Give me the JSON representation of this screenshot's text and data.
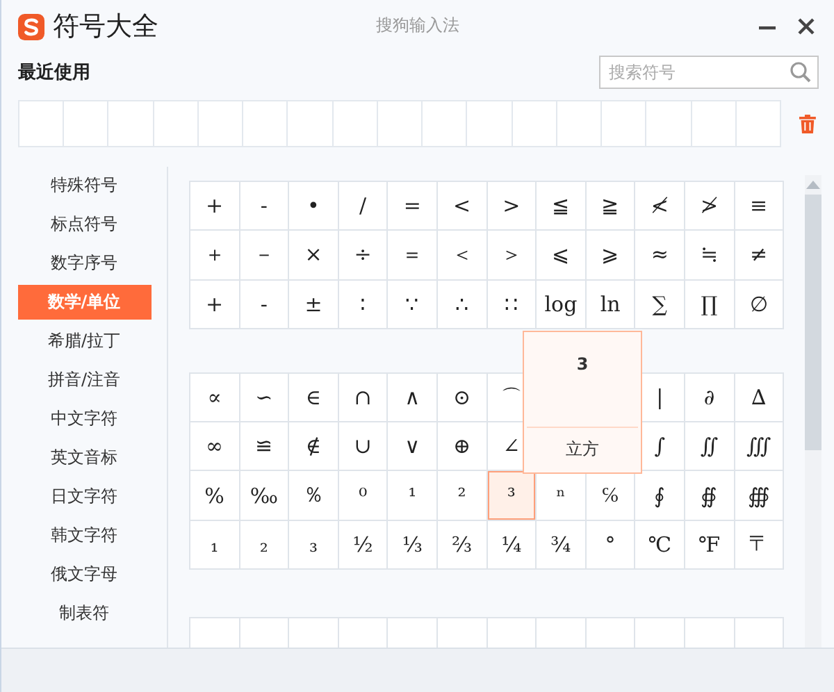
{
  "window": {
    "title": "符号大全",
    "app_name": "搜狗输入法"
  },
  "recent": {
    "label": "最近使用"
  },
  "search": {
    "placeholder": "搜索符号"
  },
  "sidebar": {
    "items": [
      {
        "label": "特殊符号",
        "selected": false
      },
      {
        "label": "标点符号",
        "selected": false
      },
      {
        "label": "数字序号",
        "selected": false
      },
      {
        "label": "数学/单位",
        "selected": true
      },
      {
        "label": "希腊/拉丁",
        "selected": false
      },
      {
        "label": "拼音/注音",
        "selected": false
      },
      {
        "label": "中文字符",
        "selected": false
      },
      {
        "label": "英文音标",
        "selected": false
      },
      {
        "label": "日文字符",
        "selected": false
      },
      {
        "label": "韩文字符",
        "selected": false
      },
      {
        "label": "俄文字母",
        "selected": false
      },
      {
        "label": "制表符",
        "selected": false
      }
    ]
  },
  "symbol_grids": [
    {
      "rows": [
        [
          {
            "s": "+",
            "selected": false
          },
          {
            "s": "-",
            "selected": false
          },
          {
            "s": "•",
            "selected": false
          },
          {
            "s": "/",
            "selected": false
          },
          {
            "s": "=",
            "selected": false
          },
          {
            "s": "<",
            "selected": false
          },
          {
            "s": ">",
            "selected": false
          },
          {
            "s": "≦",
            "selected": false
          },
          {
            "s": "≧",
            "selected": false
          },
          {
            "s": "≮",
            "selected": false
          },
          {
            "s": "≯",
            "selected": false
          },
          {
            "s": "≡",
            "selected": false
          }
        ],
        [
          {
            "s": "＋",
            "selected": false
          },
          {
            "s": "－",
            "selected": false
          },
          {
            "s": "×",
            "selected": false
          },
          {
            "s": "÷",
            "selected": false
          },
          {
            "s": "＝",
            "selected": false
          },
          {
            "s": "＜",
            "selected": false
          },
          {
            "s": "＞",
            "selected": false
          },
          {
            "s": "⩽",
            "selected": false
          },
          {
            "s": "⩾",
            "selected": false
          },
          {
            "s": "≈",
            "selected": false
          },
          {
            "s": "≒",
            "selected": false
          },
          {
            "s": "≠",
            "selected": false
          }
        ],
        [
          {
            "s": "+",
            "selected": false
          },
          {
            "s": "-",
            "selected": false
          },
          {
            "s": "±",
            "selected": false
          },
          {
            "s": "∶",
            "selected": false
          },
          {
            "s": "∵",
            "selected": false
          },
          {
            "s": "∴",
            "selected": false
          },
          {
            "s": "∷",
            "selected": false
          },
          {
            "s": "log",
            "selected": false
          },
          {
            "s": "ln",
            "selected": false
          },
          {
            "s": "∑",
            "selected": false
          },
          {
            "s": "∏",
            "selected": false
          },
          {
            "s": "∅",
            "selected": false
          }
        ]
      ]
    },
    {
      "rows": [
        [
          {
            "s": "∝",
            "selected": false
          },
          {
            "s": "∽",
            "selected": false
          },
          {
            "s": "∈",
            "selected": false
          },
          {
            "s": "∩",
            "selected": false
          },
          {
            "s": "∧",
            "selected": false
          },
          {
            "s": "⊙",
            "selected": false
          },
          {
            "s": "⌒",
            "selected": false
          },
          null,
          null,
          {
            "s": "|",
            "selected": false
          },
          {
            "s": "∂",
            "selected": false
          },
          {
            "s": "∆",
            "selected": false
          }
        ],
        [
          {
            "s": "∞",
            "selected": false
          },
          {
            "s": "≌",
            "selected": false
          },
          {
            "s": "∉",
            "selected": false
          },
          {
            "s": "∪",
            "selected": false
          },
          {
            "s": "∨",
            "selected": false
          },
          {
            "s": "⊕",
            "selected": false
          },
          {
            "s": "∠",
            "selected": false
          },
          null,
          null,
          {
            "s": "∫",
            "selected": false
          },
          {
            "s": "∬",
            "selected": false
          },
          {
            "s": "∭",
            "selected": false
          }
        ],
        [
          {
            "s": "%",
            "selected": false
          },
          {
            "s": "‰",
            "selected": false
          },
          {
            "s": "％",
            "selected": false
          },
          {
            "s": "⁰",
            "selected": false
          },
          {
            "s": "¹",
            "selected": false
          },
          {
            "s": "²",
            "selected": false
          },
          {
            "s": "³",
            "selected": true
          },
          {
            "s": "ⁿ",
            "selected": false
          },
          {
            "s": "℅",
            "selected": false
          },
          {
            "s": "∮",
            "selected": false
          },
          {
            "s": "∯",
            "selected": false
          },
          {
            "s": "∰",
            "selected": false
          }
        ],
        [
          {
            "s": "₁",
            "selected": false
          },
          {
            "s": "₂",
            "selected": false
          },
          {
            "s": "₃",
            "selected": false
          },
          {
            "s": "½",
            "selected": false
          },
          {
            "s": "⅓",
            "selected": false
          },
          {
            "s": "⅔",
            "selected": false
          },
          {
            "s": "¼",
            "selected": false
          },
          {
            "s": "¾",
            "selected": false
          },
          {
            "s": "°",
            "selected": false
          },
          {
            "s": "℃",
            "selected": false
          },
          {
            "s": "℉",
            "selected": false
          },
          {
            "s": "〒",
            "selected": false
          }
        ]
      ]
    }
  ],
  "tooltip": {
    "symbol": "3",
    "name": "立方"
  }
}
